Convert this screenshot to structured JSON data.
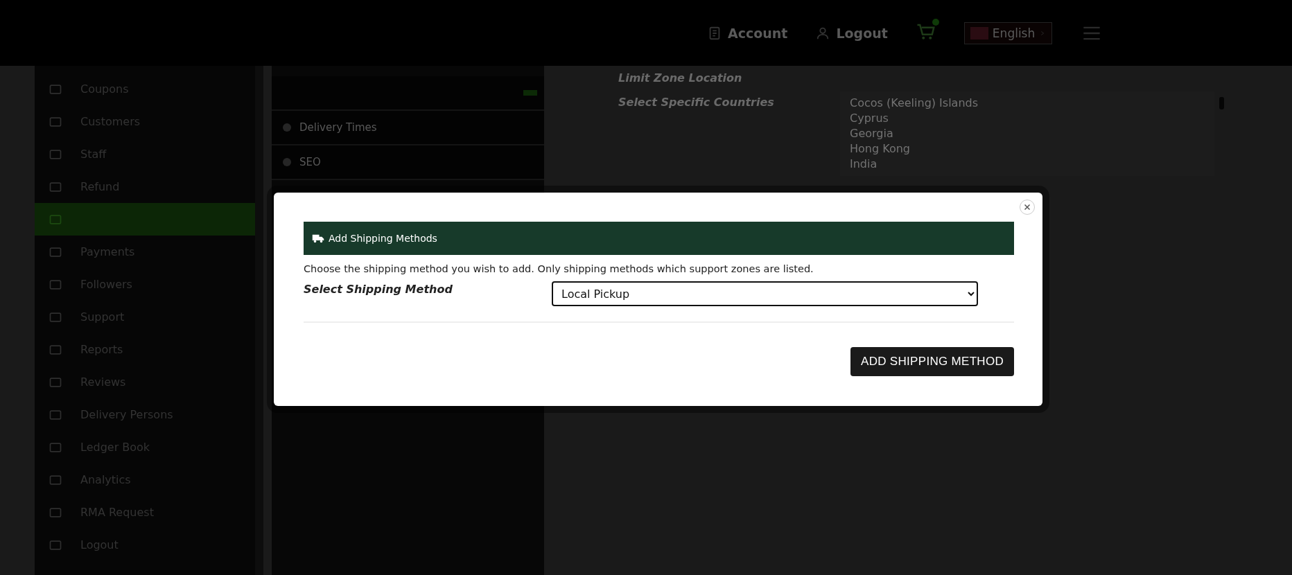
{
  "header": {
    "account": "Account",
    "logout": "Logout",
    "language": "English"
  },
  "sidebar": {
    "items": [
      {
        "label": "Coupons",
        "selected": false
      },
      {
        "label": "Customers",
        "selected": false
      },
      {
        "label": "Staff",
        "selected": false
      },
      {
        "label": "Refund",
        "selected": false
      },
      {
        "selected": true
      },
      {
        "label": "Payments",
        "selected": false
      },
      {
        "label": "Followers",
        "selected": false
      },
      {
        "label": "Support",
        "selected": false
      },
      {
        "label": "Reports",
        "selected": false
      },
      {
        "label": "Reviews",
        "selected": false
      },
      {
        "label": "Delivery Persons",
        "selected": false
      },
      {
        "label": "Ledger Book",
        "selected": false
      },
      {
        "label": "Analytics",
        "selected": false
      },
      {
        "label": "RMA Request",
        "selected": false
      },
      {
        "label": "Logout",
        "selected": false
      }
    ]
  },
  "subnav": {
    "items": [
      {
        "selected": true
      },
      {
        "label": "Delivery Times",
        "selected": false
      },
      {
        "label": "SEO",
        "selected": false
      }
    ]
  },
  "zone_form": {
    "limit_label": "Limit Zone Location",
    "countries_label": "Select Specific Countries",
    "countries": [
      "Cocos (Keeling) Islands",
      "Cyprus",
      "Georgia",
      "Hong Kong",
      "India"
    ]
  },
  "modal": {
    "title": "Add Shipping Methods",
    "description": "Choose the shipping method you wish to add. Only shipping methods which support zones are listed.",
    "field_label": "Select Shipping Method",
    "field_value": "Local Pickup",
    "button": "ADD SHIPPING METHOD"
  }
}
